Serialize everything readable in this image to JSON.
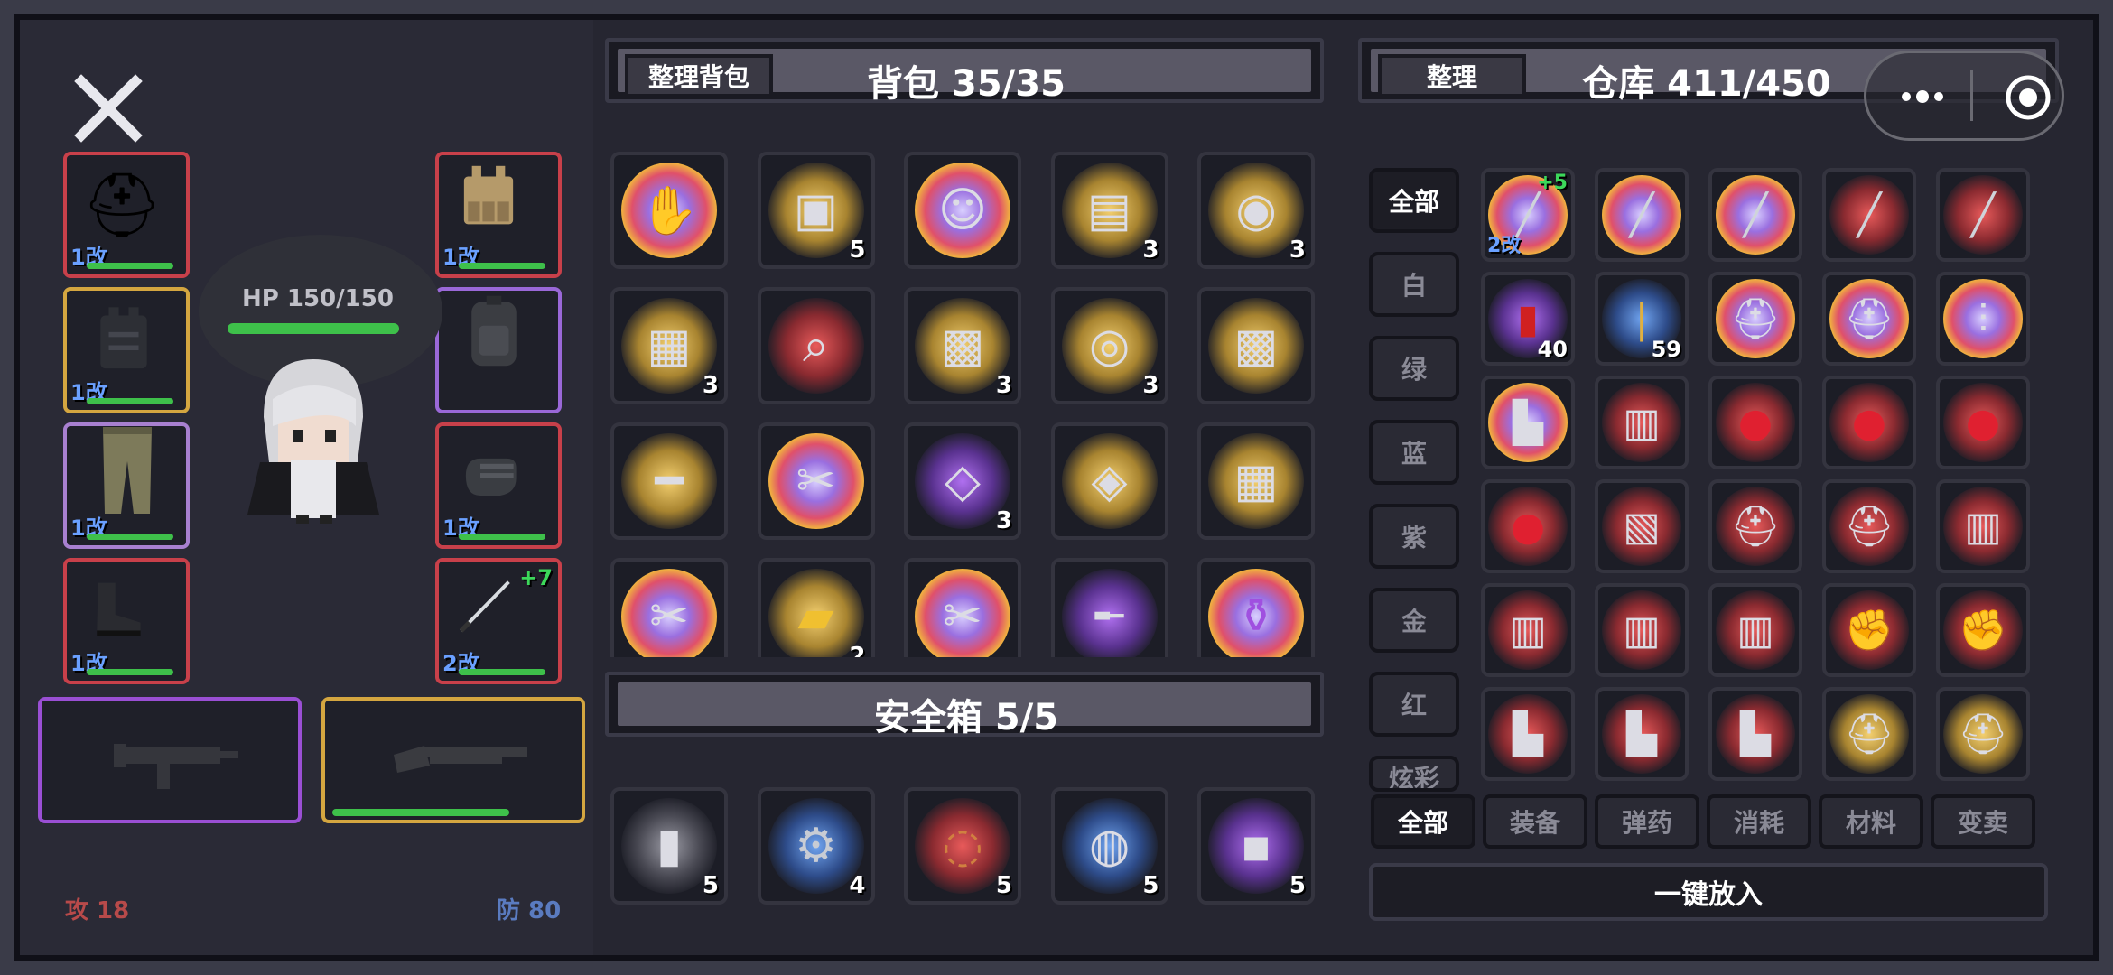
{
  "equipment": {
    "hp_label": "HP 150/150",
    "attack_label": "攻 18",
    "defense_label": "防 80",
    "slots_left": [
      {
        "name": "helmet",
        "level": "1改",
        "icon": "helmet-icon"
      },
      {
        "name": "vest",
        "level": "1改",
        "icon": "vest-icon"
      },
      {
        "name": "pants",
        "level": "1改",
        "icon": "pants-icon"
      },
      {
        "name": "boots",
        "level": "1改",
        "icon": "boots-icon"
      }
    ],
    "slots_right": [
      {
        "name": "armor",
        "level": "1改",
        "icon": "armor-icon"
      },
      {
        "name": "backpack",
        "level": "",
        "icon": "backpack-icon"
      },
      {
        "name": "gloves",
        "level": "1改",
        "icon": "gloves-icon"
      },
      {
        "name": "melee",
        "level": "2改",
        "plus": "+7",
        "icon": "blade-icon"
      }
    ]
  },
  "backpack": {
    "sort_button": "整理背包",
    "title": "背包 35/35",
    "items": [
      {
        "icon": "glove-icon",
        "glow": "rainbow",
        "count": ""
      },
      {
        "icon": "crate-icon",
        "glow": "gold",
        "count": "5"
      },
      {
        "icon": "character-card-icon",
        "glow": "rainbow",
        "count": ""
      },
      {
        "icon": "analyzer-icon",
        "glow": "gold",
        "count": "3"
      },
      {
        "icon": "record-icon",
        "glow": "gold",
        "count": "3"
      },
      {
        "icon": "toolkit-icon",
        "glow": "gold",
        "count": "3"
      },
      {
        "icon": "scanner-icon",
        "glow": "red",
        "count": ""
      },
      {
        "icon": "welder-icon",
        "glow": "gold",
        "count": "3"
      },
      {
        "icon": "lens-icon",
        "glow": "gold",
        "count": "3"
      },
      {
        "icon": "welder-icon",
        "glow": "gold",
        "count": ""
      },
      {
        "icon": "shotgun-icon",
        "glow": "gold",
        "count": ""
      },
      {
        "icon": "multitool-icon",
        "glow": "rainbow",
        "count": ""
      },
      {
        "icon": "card-icon",
        "glow": "purple",
        "count": "3"
      },
      {
        "icon": "rangefinder-icon",
        "glow": "gold",
        "count": ""
      },
      {
        "icon": "toolkit-icon",
        "glow": "gold",
        "count": ""
      },
      {
        "icon": "multitool-icon",
        "glow": "rainbow",
        "count": ""
      },
      {
        "icon": "gold-bar-icon",
        "glow": "gold",
        "count": "2"
      },
      {
        "icon": "multitool-icon",
        "glow": "rainbow",
        "count": ""
      },
      {
        "icon": "rifle-icon",
        "glow": "purple",
        "count": ""
      },
      {
        "icon": "jar-icon",
        "glow": "rainbow",
        "count": ""
      }
    ]
  },
  "safebox": {
    "title": "安全箱 5/5",
    "items": [
      {
        "icon": "shell-casing-icon",
        "glow": "gray",
        "count": "5"
      },
      {
        "icon": "gear-icon",
        "glow": "blue",
        "count": "4"
      },
      {
        "icon": "copper-coil-icon",
        "glow": "red",
        "count": "5"
      },
      {
        "icon": "bearing-icon",
        "glow": "blue",
        "count": "5"
      },
      {
        "icon": "ammo-box-icon",
        "glow": "purple",
        "count": "5"
      }
    ]
  },
  "warehouse": {
    "sort_button": "整理",
    "title": "仓库 411/450",
    "filters": [
      "全部",
      "白",
      "绿",
      "蓝",
      "紫",
      "金",
      "红",
      "炫彩"
    ],
    "tabs": [
      "全部",
      "装备",
      "弹药",
      "消耗",
      "材料",
      "变卖"
    ],
    "put_all_button": "一键放入",
    "items": [
      {
        "icon": "blade-icon",
        "glow": "rainbow",
        "count": "",
        "lvl": "2改",
        "plus": "+5"
      },
      {
        "icon": "blade-icon",
        "glow": "rainbow",
        "count": ""
      },
      {
        "icon": "blade-icon",
        "glow": "rainbow",
        "count": ""
      },
      {
        "icon": "blade-icon",
        "glow": "red",
        "count": ""
      },
      {
        "icon": "blade-icon",
        "glow": "red",
        "count": ""
      },
      {
        "icon": "shotgun-shell-icon",
        "glow": "purple",
        "count": "40"
      },
      {
        "icon": "bullet-icon",
        "glow": "blue",
        "count": "59"
      },
      {
        "icon": "helmet-icon",
        "glow": "rainbow",
        "count": ""
      },
      {
        "icon": "helmet-icon",
        "glow": "rainbow",
        "count": ""
      },
      {
        "icon": "pants-icon",
        "glow": "rainbow",
        "count": ""
      },
      {
        "icon": "boot-icon",
        "glow": "rainbow",
        "count": ""
      },
      {
        "icon": "vest-icon",
        "glow": "red",
        "count": ""
      },
      {
        "icon": "balloon-icon",
        "glow": "red",
        "count": ""
      },
      {
        "icon": "balloon-icon",
        "glow": "red",
        "count": ""
      },
      {
        "icon": "balloon-icon",
        "glow": "red",
        "count": ""
      },
      {
        "icon": "balloon-icon",
        "glow": "red",
        "count": ""
      },
      {
        "icon": "backpack-icon",
        "glow": "red",
        "count": ""
      },
      {
        "icon": "helmet-icon",
        "glow": "red",
        "count": ""
      },
      {
        "icon": "helmet-icon",
        "glow": "red",
        "count": ""
      },
      {
        "icon": "armor-icon",
        "glow": "red",
        "count": ""
      },
      {
        "icon": "armor-icon",
        "glow": "red",
        "count": ""
      },
      {
        "icon": "armor-icon",
        "glow": "red",
        "count": ""
      },
      {
        "icon": "armor-icon",
        "glow": "red",
        "count": ""
      },
      {
        "icon": "gloves-icon",
        "glow": "red",
        "count": ""
      },
      {
        "icon": "gloves-icon",
        "glow": "red",
        "count": ""
      },
      {
        "icon": "boot-icon",
        "glow": "red",
        "count": ""
      },
      {
        "icon": "boot-icon",
        "glow": "red",
        "count": ""
      },
      {
        "icon": "boot-icon",
        "glow": "red",
        "count": ""
      },
      {
        "icon": "helmet-icon",
        "glow": "gold",
        "count": ""
      },
      {
        "icon": "helmet-icon",
        "glow": "gold",
        "count": ""
      }
    ]
  },
  "capsule": {
    "more_icon": "more-dots-icon",
    "close_icon": "target-circle-icon"
  }
}
